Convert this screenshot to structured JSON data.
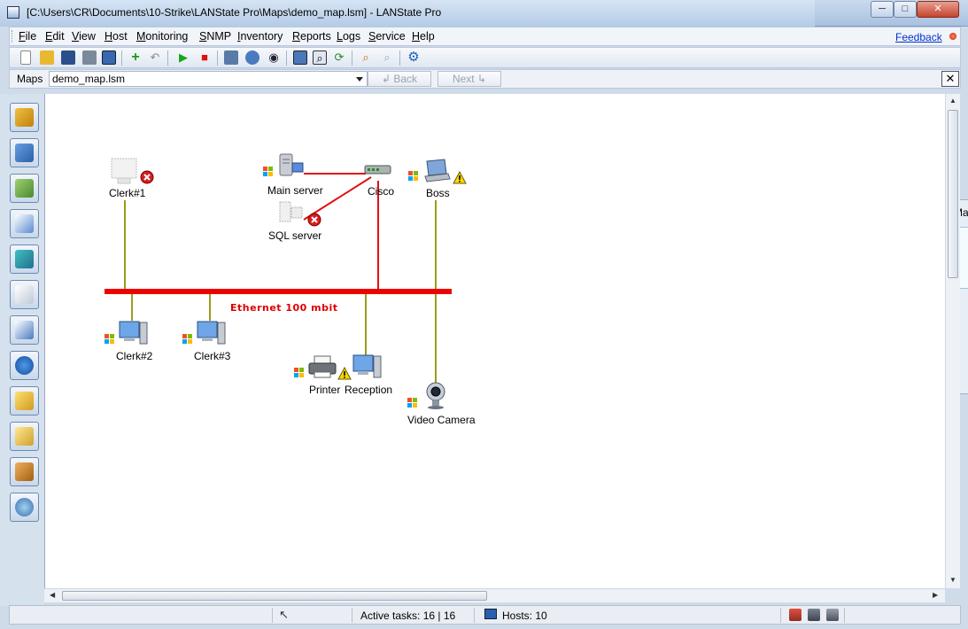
{
  "window": {
    "title": "[C:\\Users\\CR\\Documents\\10-Strike\\LANState Pro\\Maps\\demo_map.lsm] - LANState Pro"
  },
  "menu": [
    {
      "label": "File",
      "u": "F",
      "rest": "ile"
    },
    {
      "label": "Edit",
      "u": "E",
      "rest": "dit"
    },
    {
      "label": "View",
      "u": "V",
      "rest": "iew"
    },
    {
      "label": "Host",
      "u": "H",
      "rest": "ost"
    },
    {
      "label": "Monitoring",
      "u": "M",
      "rest": "onitoring"
    },
    {
      "label": "SNMP",
      "u": "S",
      "rest": "NMP"
    },
    {
      "label": "Inventory",
      "u": "I",
      "rest": "nventory"
    },
    {
      "label": "Reports",
      "u": "R",
      "rest": "eports"
    },
    {
      "label": "Logs",
      "u": "L",
      "rest": "ogs"
    },
    {
      "label": "Service",
      "u": "S",
      "rest": "ervice"
    },
    {
      "label": "Help",
      "u": "H",
      "rest": "elp"
    }
  ],
  "feedback": "Feedback",
  "maps_bar": {
    "label": "Maps",
    "current_map": "demo_map.lsm",
    "back": "Back",
    "next": "Next"
  },
  "map": {
    "ethernet_label": "Ethernet 100 mbit",
    "nodes": [
      {
        "id": "clerk1",
        "label": "Clerk#1",
        "status": "error"
      },
      {
        "id": "main-server",
        "label": "Main server",
        "status": "ok"
      },
      {
        "id": "sql-server",
        "label": "SQL server",
        "status": "error"
      },
      {
        "id": "cisco",
        "label": "Cisco",
        "status": "ok"
      },
      {
        "id": "boss",
        "label": "Boss",
        "status": "warning"
      },
      {
        "id": "clerk2",
        "label": "Clerk#2",
        "status": "ok"
      },
      {
        "id": "clerk3",
        "label": "Clerk#3",
        "status": "ok"
      },
      {
        "id": "printer",
        "label": "Printer",
        "status": "warning"
      },
      {
        "id": "reception",
        "label": "Reception",
        "status": "ok"
      },
      {
        "id": "video-camera",
        "label": "Video Camera",
        "status": "ok"
      }
    ]
  },
  "side_panel": {
    "label": "Ma"
  },
  "status": {
    "active_tasks": "Active tasks: 16 | 16",
    "hosts": "Hosts: 10"
  },
  "colors": {
    "link_lan": "#9c9c1c",
    "link_uplink": "#e01010",
    "bus": "#ee0000"
  }
}
